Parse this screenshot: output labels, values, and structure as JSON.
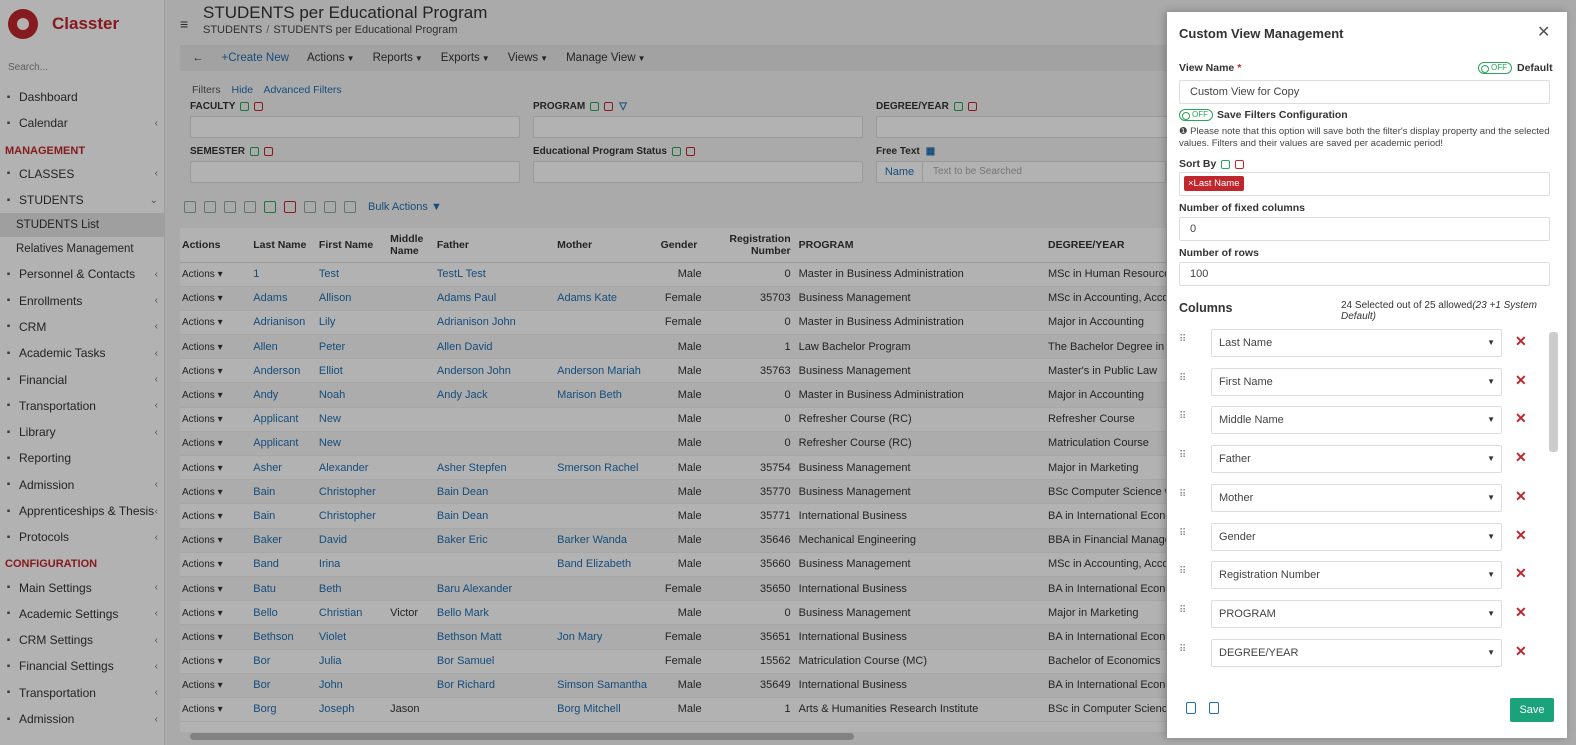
{
  "app": {
    "name": "Classter",
    "search_placeholder": "Search..."
  },
  "sidebar": {
    "items_top": [
      {
        "label": "Dashboard",
        "icon": "monitor-icon",
        "chev": ""
      },
      {
        "label": "Calendar",
        "icon": "calendar-icon",
        "chev": "‹"
      }
    ],
    "section_management": "MANAGEMENT",
    "items_mgmt": [
      {
        "label": "CLASSES",
        "icon": "classes-icon",
        "chev": "‹"
      },
      {
        "label": "STUDENTS",
        "icon": "users-icon",
        "chev": "⌄"
      }
    ],
    "students_sub": [
      "STUDENTS List",
      "Relatives Management"
    ],
    "items_mgmt2": [
      {
        "label": "Personnel & Contacts",
        "icon": "contacts-icon",
        "chev": "‹"
      },
      {
        "label": "Enrollments",
        "icon": "enroll-icon",
        "chev": "‹"
      },
      {
        "label": "CRM",
        "icon": "crm-icon",
        "chev": "‹"
      },
      {
        "label": "Academic Tasks",
        "icon": "tasks-icon",
        "chev": "‹"
      },
      {
        "label": "Financial",
        "icon": "financial-icon",
        "chev": "‹"
      },
      {
        "label": "Transportation",
        "icon": "bus-icon",
        "chev": "‹"
      },
      {
        "label": "Library",
        "icon": "library-icon",
        "chev": "‹"
      },
      {
        "label": "Reporting",
        "icon": "report-icon",
        "chev": ""
      },
      {
        "label": "Admission",
        "icon": "admission-icon",
        "chev": "‹"
      },
      {
        "label": "Apprenticeships & Thesis",
        "icon": "thesis-icon",
        "chev": "‹"
      },
      {
        "label": "Protocols",
        "icon": "protocol-icon",
        "chev": "‹"
      }
    ],
    "section_config": "CONFIGURATION",
    "items_config": [
      {
        "label": "Main Settings",
        "icon": "settings-icon",
        "chev": "‹"
      },
      {
        "label": "Academic Settings",
        "icon": "grid-icon",
        "chev": "‹"
      },
      {
        "label": "CRM Settings",
        "icon": "crm-icon",
        "chev": "‹"
      },
      {
        "label": "Financial Settings",
        "icon": "financial-icon",
        "chev": "‹"
      },
      {
        "label": "Transportation",
        "icon": "bus-icon",
        "chev": "‹"
      },
      {
        "label": "Admission",
        "icon": "admission-icon",
        "chev": "‹"
      }
    ]
  },
  "header": {
    "title": "STUDENTS per Educational Program",
    "crumb1": "STUDENTS",
    "crumb_sep": "/",
    "crumb2": "STUDENTS per Educational Program"
  },
  "toolbar": {
    "back": "←",
    "create": "+Create New",
    "actions": "Actions",
    "reports": "Reports",
    "exports": "Exports",
    "views": "Views",
    "manage_view": "Manage View"
  },
  "filters": {
    "links": {
      "filters": "Filters",
      "hide": "Hide",
      "advanced": "Advanced Filters"
    },
    "faculty": "FACULTY",
    "program": "PROGRAM",
    "degree": "DEGREE/YEAR",
    "semester": "SEMESTER",
    "status": "Educational Program Status",
    "free_text": "Free Text",
    "free_name": "Name",
    "free_placeholder": "Text to be Searched"
  },
  "bulk": {
    "label": "Bulk Actions"
  },
  "table": {
    "headers": [
      "Actions",
      "Last Name",
      "First Name",
      "Middle Name",
      "Father",
      "Mother",
      "Gender",
      "Registration Number",
      "PROGRAM",
      "DEGREE/YEAR"
    ],
    "action_label": "Actions",
    "rows": [
      [
        "1",
        "Test",
        "",
        "TestL Test",
        "",
        "Male",
        "0",
        "Master in Business Administration",
        "MSc in Human Resource Management & Organisational Behaviour"
      ],
      [
        "Adams",
        "Allison",
        "",
        "Adams Paul",
        "Adams Kate",
        "Female",
        "35703",
        "Business Management",
        "MSc in Accounting, Accountability & Financial Management"
      ],
      [
        "Adrianison",
        "Lily",
        "",
        "Adrianison John",
        "",
        "Female",
        "0",
        "Master in Business Administration",
        "Major in Accounting"
      ],
      [
        "Allen",
        "Peter",
        "",
        "Allen David",
        "",
        "Male",
        "1",
        "Law Bachelor Program",
        "The Bachelor Degree in Law Program (LLB)"
      ],
      [
        "Anderson",
        "Elliot",
        "",
        "Anderson John",
        "Anderson Mariah",
        "Male",
        "35763",
        "Business Management",
        "Master's in Public Law"
      ],
      [
        "Andy",
        "Noah",
        "",
        "Andy Jack",
        "Marison Beth",
        "Male",
        "0",
        "Master in Business Administration",
        "Major in Accounting"
      ],
      [
        "Applicant",
        "New",
        "",
        "",
        "",
        "Male",
        "0",
        "Refresher Course (RC)",
        "Refresher Course"
      ],
      [
        "Applicant",
        "New",
        "",
        "",
        "",
        "Male",
        "0",
        "Refresher Course (RC)",
        "Matriculation Course"
      ],
      [
        "Asher",
        "Alexander",
        "",
        "Asher Stepfen",
        "Smerson Rachel",
        "Male",
        "35754",
        "Business Management",
        "Major in Marketing"
      ],
      [
        "Bain",
        "Christopher",
        "",
        "Bain Dean",
        "",
        "Male",
        "35770",
        "Business Management",
        "BSc Computer Science with Management"
      ],
      [
        "Bain",
        "Christopher",
        "",
        "Bain Dean",
        "",
        "Male",
        "35771",
        "International Business",
        "BA in International Economy"
      ],
      [
        "Baker",
        "David",
        "",
        "Baker Eric",
        "Barker Wanda",
        "Male",
        "35646",
        "Mechanical Engineering",
        "BBA in Financial Management"
      ],
      [
        "Band",
        "Irina",
        "",
        "",
        "Band Elizabeth",
        "Male",
        "35660",
        "Business Management",
        "MSc in Accounting, Accountability & Financial Management"
      ],
      [
        "Batu",
        "Beth",
        "",
        "Baru Alexander",
        "",
        "Female",
        "35650",
        "International Business",
        "BA in International Economy"
      ],
      [
        "Bello",
        "Christian",
        "Victor",
        "Bello Mark",
        "",
        "Male",
        "0",
        "Business Management",
        "Major in Marketing"
      ],
      [
        "Bethson",
        "Violet",
        "",
        "Bethson Matt",
        "Jon Mary",
        "Female",
        "35651",
        "International Business",
        "BA in International Economy"
      ],
      [
        "Bor",
        "Julia",
        "",
        "Bor Samuel",
        "",
        "Female",
        "15562",
        "Matriculation Course (MC)",
        "Bachelor of Economics"
      ],
      [
        "Bor",
        "John",
        "",
        "Bor Richard",
        "Simson Samantha",
        "Male",
        "35649",
        "International Business",
        "BA in International Economy"
      ],
      [
        "Borg",
        "Joseph",
        "Jason",
        "",
        "Borg Mitchell",
        "Male",
        "1",
        "Arts & Humanities Research Institute",
        "BSc in Computer Science"
      ]
    ]
  },
  "modal": {
    "title": "Custom View Management",
    "close": "✕",
    "view_name_label": "View Name",
    "required_mark": "*",
    "toggle_off": "OFF",
    "default_label": "Default",
    "view_name_value": "Custom View for Copy",
    "save_filters_label": "Save Filters Configuration",
    "note": "Please note that this option will save both the filter's display property and the selected values. Filters and their values are saved per academic period!",
    "note_icon": "❶",
    "sort_by_label": "Sort By",
    "sort_tag": "×Last Name",
    "fixed_cols_label": "Number of fixed columns",
    "fixed_cols_value": "0",
    "rows_label": "Number of rows",
    "rows_value": "100",
    "columns_title": "Columns",
    "columns_count": "24 Selected out of 25 allowed",
    "columns_count_note": "(23 +1 System Default)",
    "columns": [
      "Last Name",
      "First Name",
      "Middle Name",
      "Father",
      "Mother",
      "Gender",
      "Registration Number",
      "PROGRAM",
      "DEGREE/YEAR"
    ],
    "save": "Save"
  },
  "colors": {
    "brand": "#c0272d",
    "link": "#1f6fb2",
    "save": "#1aa37a"
  }
}
